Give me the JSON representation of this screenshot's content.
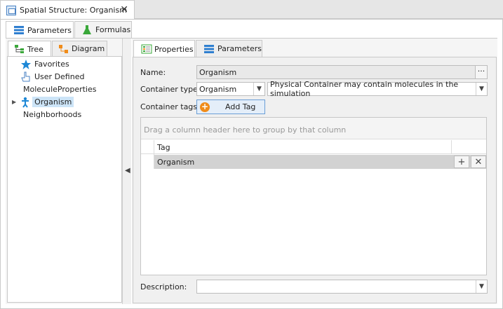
{
  "document_tab": {
    "title": "Spatial Structure: Organism",
    "close": "✕"
  },
  "top_tabs": [
    {
      "label": "Parameters"
    },
    {
      "label": "Formulas"
    }
  ],
  "left_tabs": [
    {
      "label": "Tree"
    },
    {
      "label": "Diagram"
    }
  ],
  "tree": {
    "items": [
      {
        "label": "Favorites"
      },
      {
        "label": "User Defined"
      },
      {
        "label": "MoleculeProperties"
      },
      {
        "label": "Organism"
      },
      {
        "label": "Neighborhoods"
      }
    ]
  },
  "right_tabs": [
    {
      "label": "Properties"
    },
    {
      "label": "Parameters"
    }
  ],
  "form": {
    "name_label": "Name:",
    "name_value": "Organism",
    "ellipsis": "···",
    "container_type_label": "Container type:",
    "container_type_value": "Organism",
    "container_mode_value": "Physical Container may contain molecules in the simulation",
    "container_tags_label": "Container tags:",
    "add_tag_label": "Add Tag",
    "description_label": "Description:",
    "description_value": ""
  },
  "grid": {
    "group_panel_text": "Drag a column header here to group by that column",
    "column_header": "Tag",
    "rows": [
      {
        "tag": "Organism"
      }
    ],
    "add_symbol": "+",
    "remove_symbol": "✕"
  },
  "colors": {
    "selection": "#cce4f7",
    "accent": "#6a9ed6",
    "add_icon": "#f08c1a",
    "tree_icon_blue": "#1e88d6"
  }
}
